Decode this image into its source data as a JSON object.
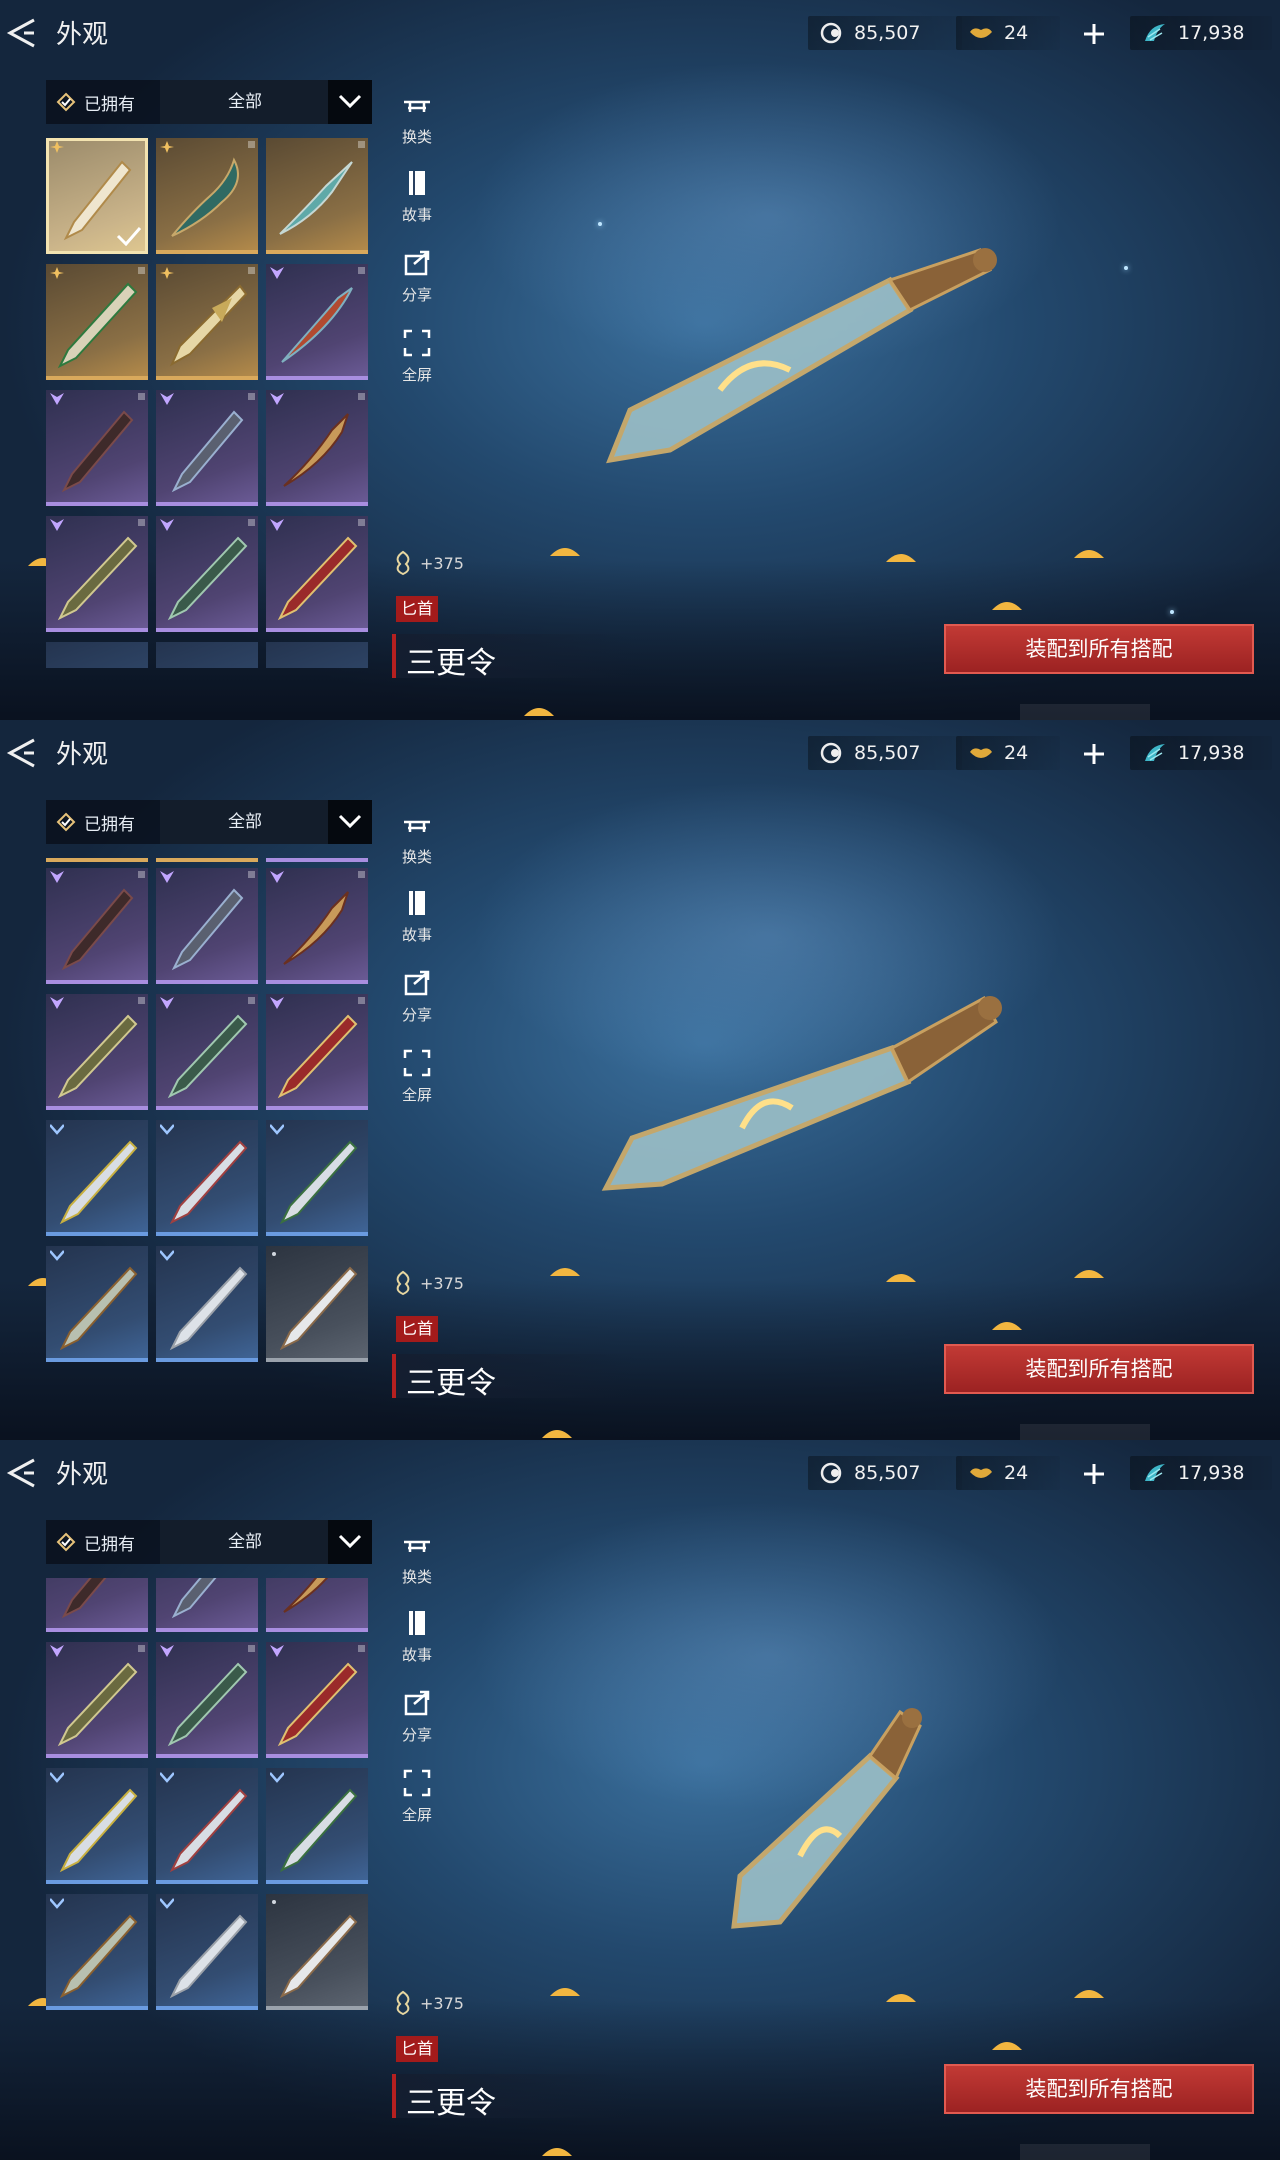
{
  "header": {
    "title": "外观",
    "currencies": [
      {
        "icon": "silver-coin-icon",
        "value": "85,507"
      },
      {
        "icon": "gold-ingot-icon",
        "value": "24"
      },
      {
        "icon": "jade-icon",
        "value": "17,938"
      }
    ]
  },
  "filter": {
    "owned_label": "已拥有",
    "category_label": "全部"
  },
  "side_actions": [
    {
      "icon": "switch-weapon-icon",
      "label": "换类"
    },
    {
      "icon": "story-book-icon",
      "label": "故事"
    },
    {
      "icon": "share-icon",
      "label": "分享"
    },
    {
      "icon": "fullscreen-icon",
      "label": "全屏"
    }
  ],
  "selected_item": {
    "power": "+375",
    "type": "匕首",
    "name": "三更令"
  },
  "equip_button": "装配到所有搭配",
  "colors": {
    "gold_rarity": "#d9a95c",
    "purple_rarity": "#a88ee0",
    "blue_rarity": "#6a9be0",
    "accent_red": "#a31b1b"
  }
}
